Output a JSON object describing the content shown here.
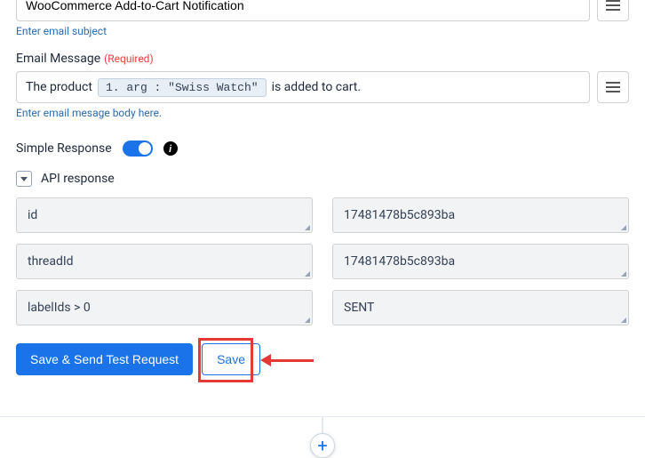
{
  "subject": {
    "value": "WooCommerce Add-to-Cart Notification",
    "helper": "Enter email subject"
  },
  "message": {
    "label": "Email Message",
    "required": "(Required)",
    "prefix": "The product",
    "tag": "1. arg : \"Swiss Watch\"",
    "suffix": "is added to cart.",
    "helper": "Enter email mesage body here."
  },
  "simple_response_label": "Simple Response",
  "api_response_label": "API response",
  "api_rows": [
    {
      "key": "id",
      "val": "17481478b5c893ba"
    },
    {
      "key": "threadId",
      "val": "17481478b5c893ba"
    },
    {
      "key": "labelIds > 0",
      "val": "SENT"
    }
  ],
  "buttons": {
    "primary": "Save & Send Test Request",
    "secondary": "Save"
  },
  "plus": "+",
  "info_glyph": "i"
}
